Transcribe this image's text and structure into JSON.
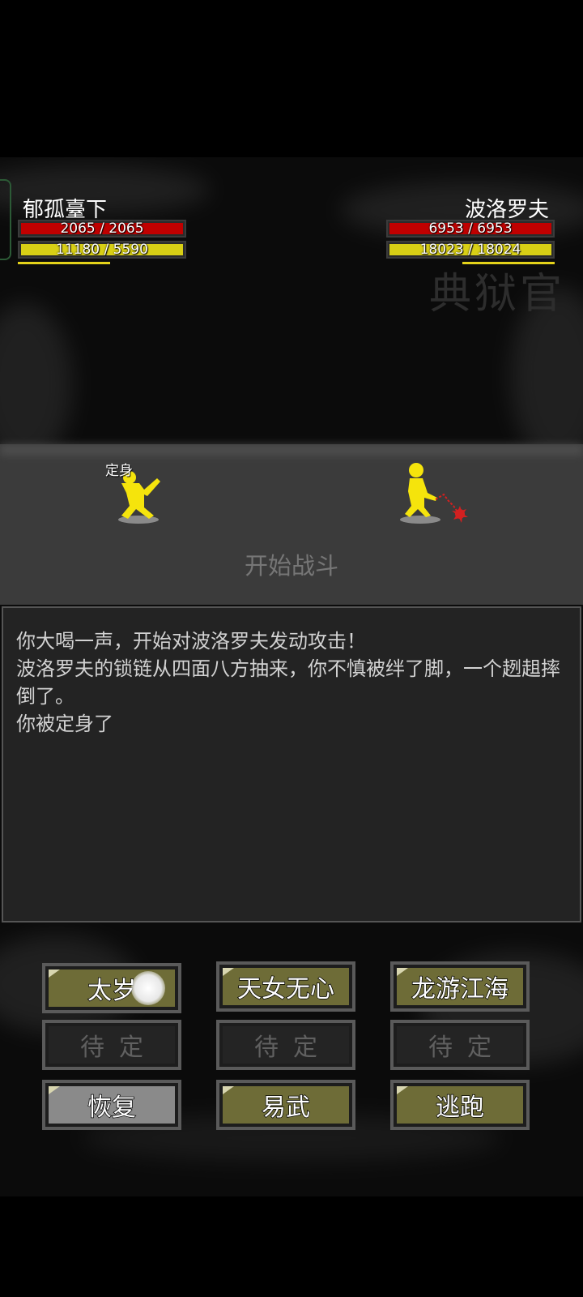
{
  "player": {
    "name": "郁孤臺下",
    "hp_text": "2065 / 2065",
    "hp_fraction": 1.0,
    "mp_text": "11180 / 5590",
    "mp_fraction": 1.0,
    "status": "定身"
  },
  "enemy": {
    "name": "波洛罗夫",
    "hp_text": "6953 / 6953",
    "hp_fraction": 1.0,
    "mp_text": "18023 / 18024",
    "mp_fraction": 1.0
  },
  "watermark": "典狱官",
  "battle_label": "开始战斗",
  "log": [
    "你大喝一声，开始对波洛罗夫发动攻击！",
    "波洛罗夫的锁链从四面八方抽来，你不慎被绊了脚，一个趔趄摔倒了。",
    "你被定身了"
  ],
  "skills": [
    {
      "label": "太岁"
    },
    {
      "label": "天女无心"
    },
    {
      "label": "龙游江海"
    }
  ],
  "slots": [
    {
      "label": "待定"
    },
    {
      "label": "待定"
    },
    {
      "label": "待定"
    }
  ],
  "actions": {
    "recover": "恢复",
    "switch_weapon": "易武",
    "flee": "逃跑"
  },
  "colors": {
    "hp": "#c00000",
    "mp": "#d8cf15",
    "button_olive": "#6e6c37",
    "button_grey": "#8a8a8a",
    "figure": "#f5e40c",
    "chain": "#d42020"
  }
}
